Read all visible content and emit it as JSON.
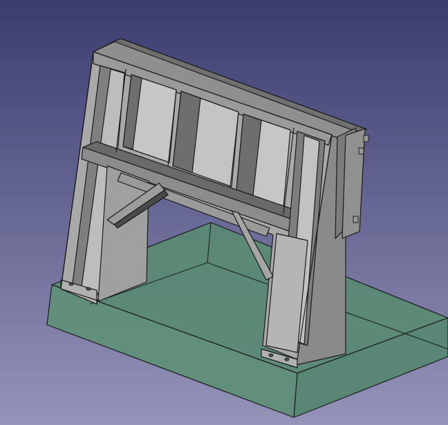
{
  "view": {
    "background_top": "#3b3d6f",
    "background_bottom": "#9493b9"
  },
  "model": {
    "body_color": "#a9a9a9",
    "body_shade": "#7d7d7d",
    "body_dark": "#5c5c5c",
    "edge_color": "#1a1a1a",
    "base_plate_color": "#5a8a73",
    "base_plate_side_color": "#4f7c66"
  }
}
